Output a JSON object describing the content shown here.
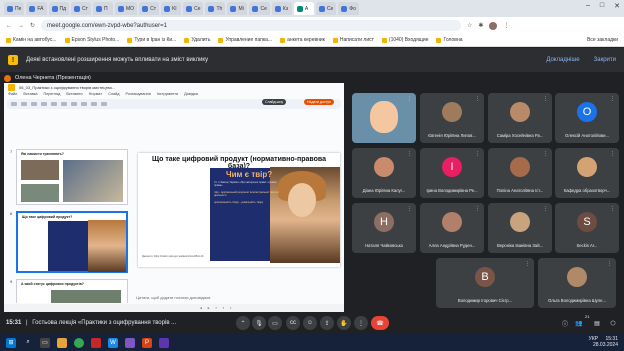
{
  "browser": {
    "tabs": [
      "Пе",
      "FA",
      "Пд",
      "Ст",
      "П",
      "МО",
      "Ст",
      "Kl",
      "Се",
      "Th",
      "Mi",
      "Се",
      "Кз",
      "А",
      "Се",
      "Фо"
    ],
    "url": "meet.google.com/ewn-zvpd-wbe?authuser=1",
    "bookmarks": [
      "Камін на автобус...",
      "Epson Stylus Photo...",
      "Тури в Іран із Ки...",
      "Удалить",
      "Управление папка...",
      "анкета керевник",
      "Написати лист",
      "(1040) Входящие",
      "Головна"
    ],
    "all_bookmarks": "Все закладки"
  },
  "banner": {
    "text": "Деякі встановлені розширення можуть впливати на зміст виклику",
    "details": "Докладніше",
    "close": "Закрити"
  },
  "presenter": "Олена Чернета (Презентація)",
  "slides": {
    "doc_title": "06_03_Практики з оцифрування творів мистецтва...",
    "menu": [
      "Файл",
      "Вставка",
      "Перегляд",
      "Вставити",
      "Формат",
      "Слайд",
      "Розташування",
      "Інструменти",
      "Довідка"
    ],
    "slideshow_btn": "Слайд-шоу",
    "share_btn": "Надати доступ",
    "thumb_titles": [
      "Які намисти трапляють?",
      "Що таке цифровий продукт?",
      "А який статус цифрових продуктів?"
    ],
    "thumb_numbers": [
      "7",
      "8",
      "9"
    ],
    "main_title": "Що таке цифровий продукт (нормативно-правова база)?",
    "main_question": "Чим є твір?",
    "main_text_1": "Ст. 1 Закону України «Про авторське право і суміжні права»",
    "main_text_2": "твір - оригінальний результат інтелектуальної творчої діяльності",
    "main_text_3": "оригінальність твору - унікальність твору",
    "main_link": "Джерело: https://zakon.rada.gov.ua/laws/show/2811-20",
    "notes": "Цитати, щоб додати нотатки доповідача"
  },
  "participants": [
    {
      "name": "",
      "initial": "",
      "color": "#f4c7a1",
      "self_view": true
    },
    {
      "name": "Євгенія Юріївна Липов...",
      "initial": "",
      "color": "#9e7b5c"
    },
    {
      "name": "Саміра Хосейнівна Ра...",
      "initial": "",
      "color": "#b88a6a"
    },
    {
      "name": "Олексій Анатолійови...",
      "initial": "O",
      "color": "#1a73e8"
    },
    {
      "name": "Діана Юріївна Калуг...",
      "initial": "",
      "color": "#c98b6b"
    },
    {
      "name": "Ірина Володимирівна Ре...",
      "initial": "I",
      "color": "#e91e63"
    },
    {
      "name": "Поліна Анатоліївна Іст...",
      "initial": "",
      "color": "#a56b4a"
    },
    {
      "name": "Кафедра образотворч...",
      "initial": "",
      "color": "#d4a373"
    },
    {
      "name": "Наталя Чайковська",
      "initial": "H",
      "color": "#8d6e63"
    },
    {
      "name": "Алла Андріївна Руден...",
      "initial": "",
      "color": "#b0806a"
    },
    {
      "name": "Вероніка Іванівна Зай...",
      "initial": "",
      "color": "#c9a27e"
    },
    {
      "name": "Seckin Ar...",
      "initial": "S",
      "color": "#6d4c41"
    },
    {
      "name": "Володимир Ігорович Сієгр...",
      "initial": "B",
      "color": "#795548"
    },
    {
      "name": "Ольга Володимирівна Шуле...",
      "initial": "",
      "color": "#b08968"
    }
  ],
  "meeting": {
    "time": "15:31",
    "title": "Гостьова лекція «Практики з оцифрування творів ...",
    "participant_count": "21"
  },
  "tray": {
    "time": "15:31",
    "date": "28.03.2024",
    "lang": "УКР"
  }
}
